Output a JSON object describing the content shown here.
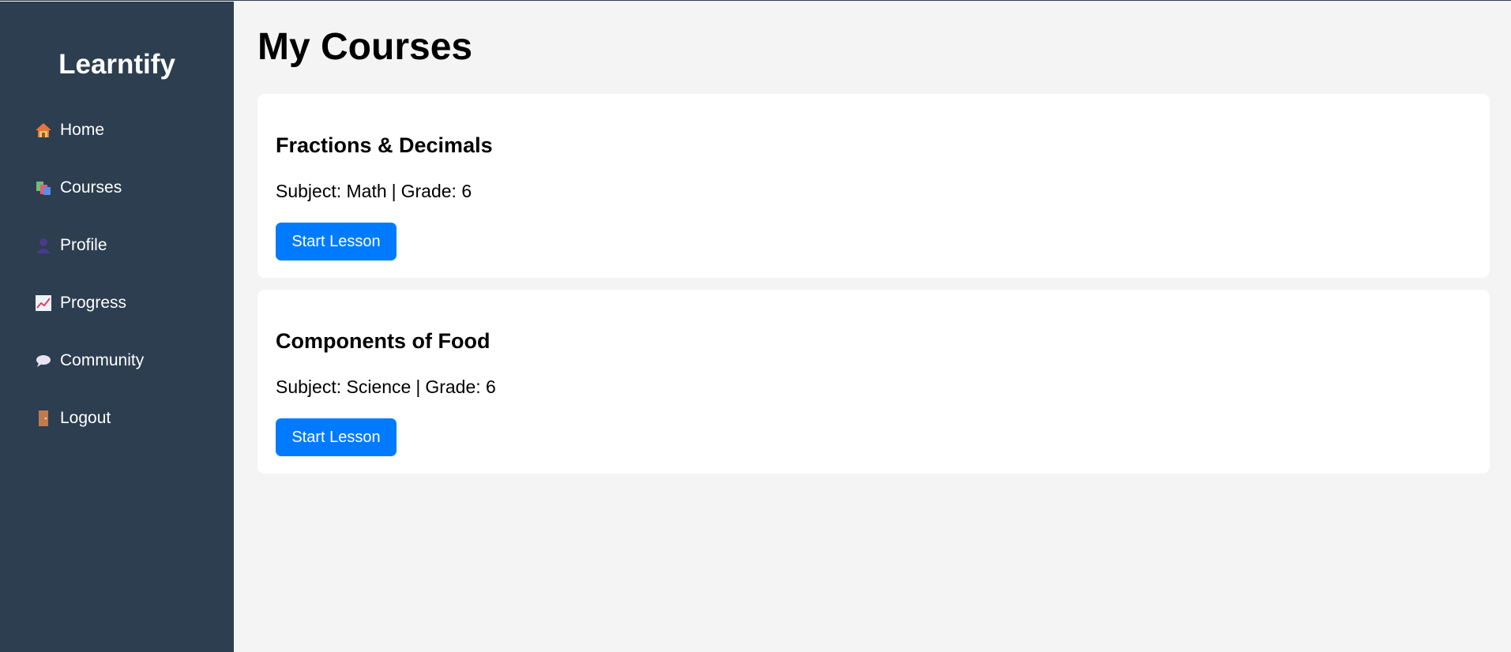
{
  "app": {
    "name": "Learntify"
  },
  "sidebar": {
    "items": [
      {
        "label": "Home",
        "icon": "house-icon"
      },
      {
        "label": "Courses",
        "icon": "books-icon"
      },
      {
        "label": "Profile",
        "icon": "user-icon"
      },
      {
        "label": "Progress",
        "icon": "chart-icon"
      },
      {
        "label": "Community",
        "icon": "speech-bubble-icon"
      },
      {
        "label": "Logout",
        "icon": "door-icon"
      }
    ]
  },
  "main": {
    "title": "My Courses",
    "courses": [
      {
        "title": "Fractions & Decimals",
        "subject_label": "Subject: Math",
        "grade_label": "Grade: 6",
        "button": "Start Lesson"
      },
      {
        "title": "Components of Food",
        "subject_label": "Subject: Science",
        "grade_label": "Grade: 6",
        "button": "Start Lesson"
      }
    ]
  },
  "colors": {
    "sidebar_bg": "#2c3e50",
    "page_bg": "#f4f4f4",
    "primary_button": "#007bff"
  }
}
